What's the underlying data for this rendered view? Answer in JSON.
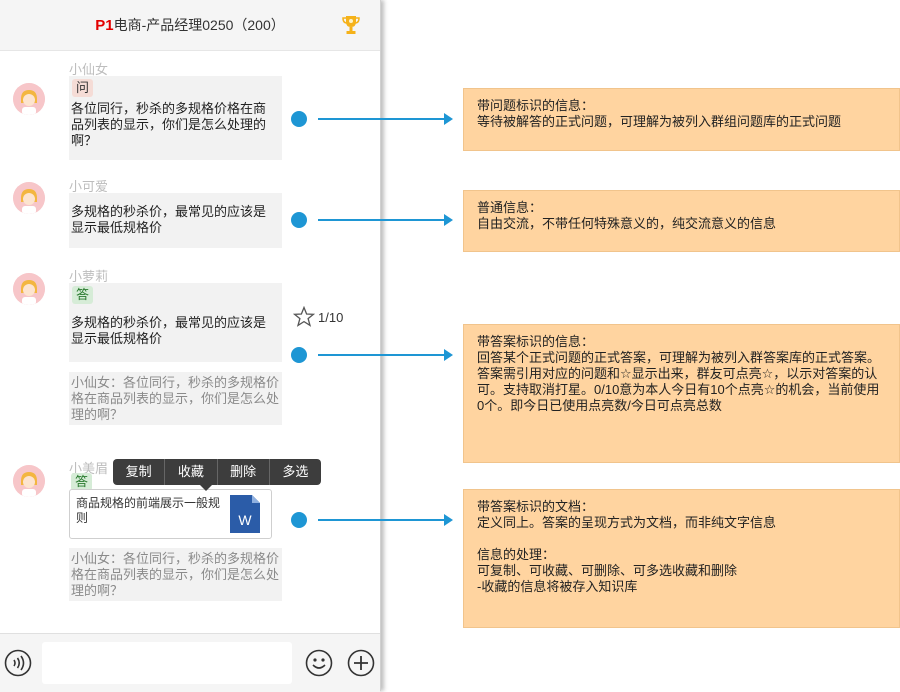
{
  "colors": {
    "accent": "#1e96d4",
    "note_bg": "#ffd4a0",
    "brand_red": "#e30000"
  },
  "header": {
    "prefix": "P1",
    "title": "电商-产品经理0250（200）"
  },
  "messages": [
    {
      "nick": "小仙女",
      "tag": "问",
      "text": "各位同行，秒杀的多规格价格在商品列表的显示，你们是怎么处理的啊？"
    },
    {
      "nick": "小可爱",
      "text": "多规格的秒杀价，最常见的应该是显示最低规格价"
    },
    {
      "nick": "小萝莉",
      "tag": "答",
      "text": "多规格的秒杀价，最常见的应该是显示最低规格价",
      "quote": "小仙女：各位同行，秒杀的多规格价格在商品列表的显示，你们是怎么处理的啊？",
      "rating": "1/10"
    },
    {
      "nick": "小美眉",
      "tag": "答",
      "doc_title": "商品规格的前端展示一般规则",
      "doc_icon": "word-doc-icon",
      "doc_icon_letter": "W",
      "quote": "小仙女：各位同行，秒杀的多规格价格在商品列表的显示，你们是怎么处理的啊？"
    }
  ],
  "context_menu": [
    "复制",
    "收藏",
    "删除",
    "多选"
  ],
  "input": {
    "value": "",
    "placeholder": ""
  },
  "notes": [
    {
      "lines": [
        "带问题标识的信息：",
        "等待被解答的正式问题，可理解为被列入群组问题库的正式问题"
      ]
    },
    {
      "lines": [
        "普通信息：",
        "自由交流，不带任何特殊意义的，纯交流意义的信息"
      ]
    },
    {
      "lines": [
        "带答案标识的信息：",
        "回答某个正式问题的正式答案，可理解为被列入群答案库的正式答案。答案需引用对应的问题和☆显示出来，群友可点亮☆，以示对答案的认可。支持取消打星。0/10意为本人今日有10个点亮☆的机会，当前使用0个。即今日已使用点亮数/今日可点亮总数"
      ]
    },
    {
      "lines": [
        "带答案标识的文档：",
        "定义同上。答案的呈现方式为文档，而非纯文字信息",
        "",
        "信息的处理：",
        "可复制、可收藏、可删除、可多选收藏和删除",
        "-收藏的信息将被存入知识库"
      ]
    }
  ]
}
